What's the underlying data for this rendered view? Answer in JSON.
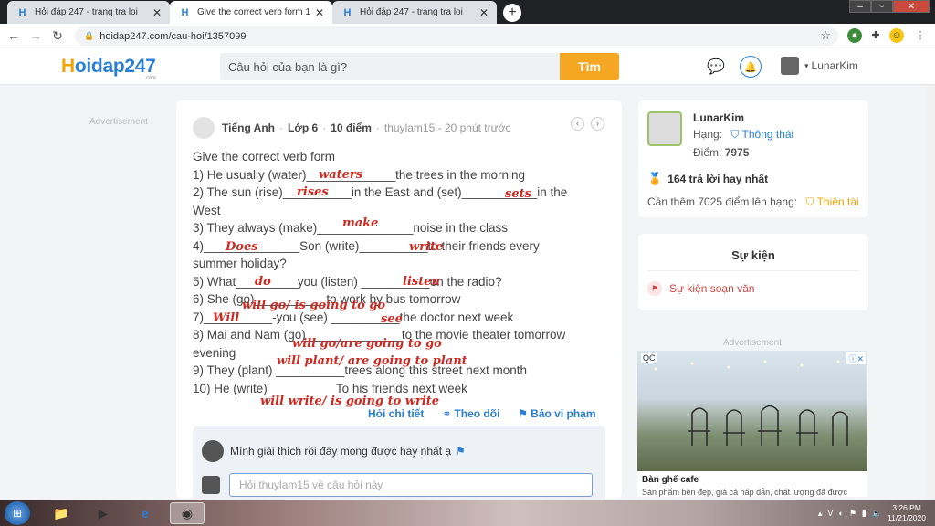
{
  "browser": {
    "tabs": [
      {
        "label": "Hỏi đáp 247 - trang tra loi",
        "active": false
      },
      {
        "label": "Give the correct verb form 1) He",
        "active": true
      },
      {
        "label": "Hỏi đáp 247 - trang tra loi",
        "active": false
      }
    ],
    "url": "hoidap247.com/cau-hoi/1357099"
  },
  "header": {
    "logo_h": "H",
    "logo_text": "oidap247",
    "logo_com": ".com",
    "search_placeholder": "Câu hỏi của bạn là gì?",
    "search_button": "Tìm",
    "username": "LunarKim"
  },
  "ads": {
    "left_label": "Advertisement",
    "right_label": "Advertisement",
    "qc": "QC",
    "title": "Bàn ghế cafe",
    "desc": "Sản phẩm bền đẹp, giá cả hấp dẫn, chất lượng đã được"
  },
  "question": {
    "subject": "Tiếng Anh",
    "grade": "Lớp 6",
    "points": "10 điểm",
    "author_time": "thuylam15 - 20 phút trước",
    "lines": [
      "Give the correct verb form",
      "1) He usually (water)_____________the trees in the morning",
      "2) The sun (rise)__________in the East and (set)___________in the",
      "West",
      "3) They always (make)______________noise in the class",
      "4)______________Son (write)__________to their friends every",
      "summer holiday?",
      "5) What_________you (listen) __________on the radio?",
      "6) She (go)__________ to work by bus tomorrow",
      "7)__________-you (see) __________the doctor next week",
      "8) Mai and Nam (go)______________to the movie theater tomorrow",
      "evening",
      "9) They (plant) __________trees along this street next month",
      "10) He (write)__________To his friends next week"
    ],
    "handwriting": [
      "waters",
      "rises",
      "sets",
      "make",
      "Does",
      "write",
      "do",
      "listen",
      "will go/ is going to go",
      "Will",
      "see",
      "will go/are going to go",
      "will plant/ are going to plant",
      "will write/ is going to write"
    ],
    "actions": [
      "Hỏi chi tiết",
      "Theo dõi",
      "Báo vi phạm"
    ],
    "comment": "Mình giải thích rồi đấy mong được hay nhất ạ",
    "reply_placeholder": "Hỏi thuylam15 về câu hỏi này"
  },
  "profile": {
    "name": "LunarKim",
    "rank_label": "Hạng:",
    "rank_value": "Thông thái",
    "points_label": "Điểm:",
    "points_value": "7975",
    "best_answers": "164 trả lời hay nhất",
    "need_label": "Cần thêm 7025 điểm lên hạng:",
    "next_rank": "Thiên tài"
  },
  "events": {
    "title": "Sự kiện",
    "item": "Sự kiện soạn văn"
  },
  "taskbar": {
    "time": "3:26 PM",
    "date": "11/21/2020"
  }
}
